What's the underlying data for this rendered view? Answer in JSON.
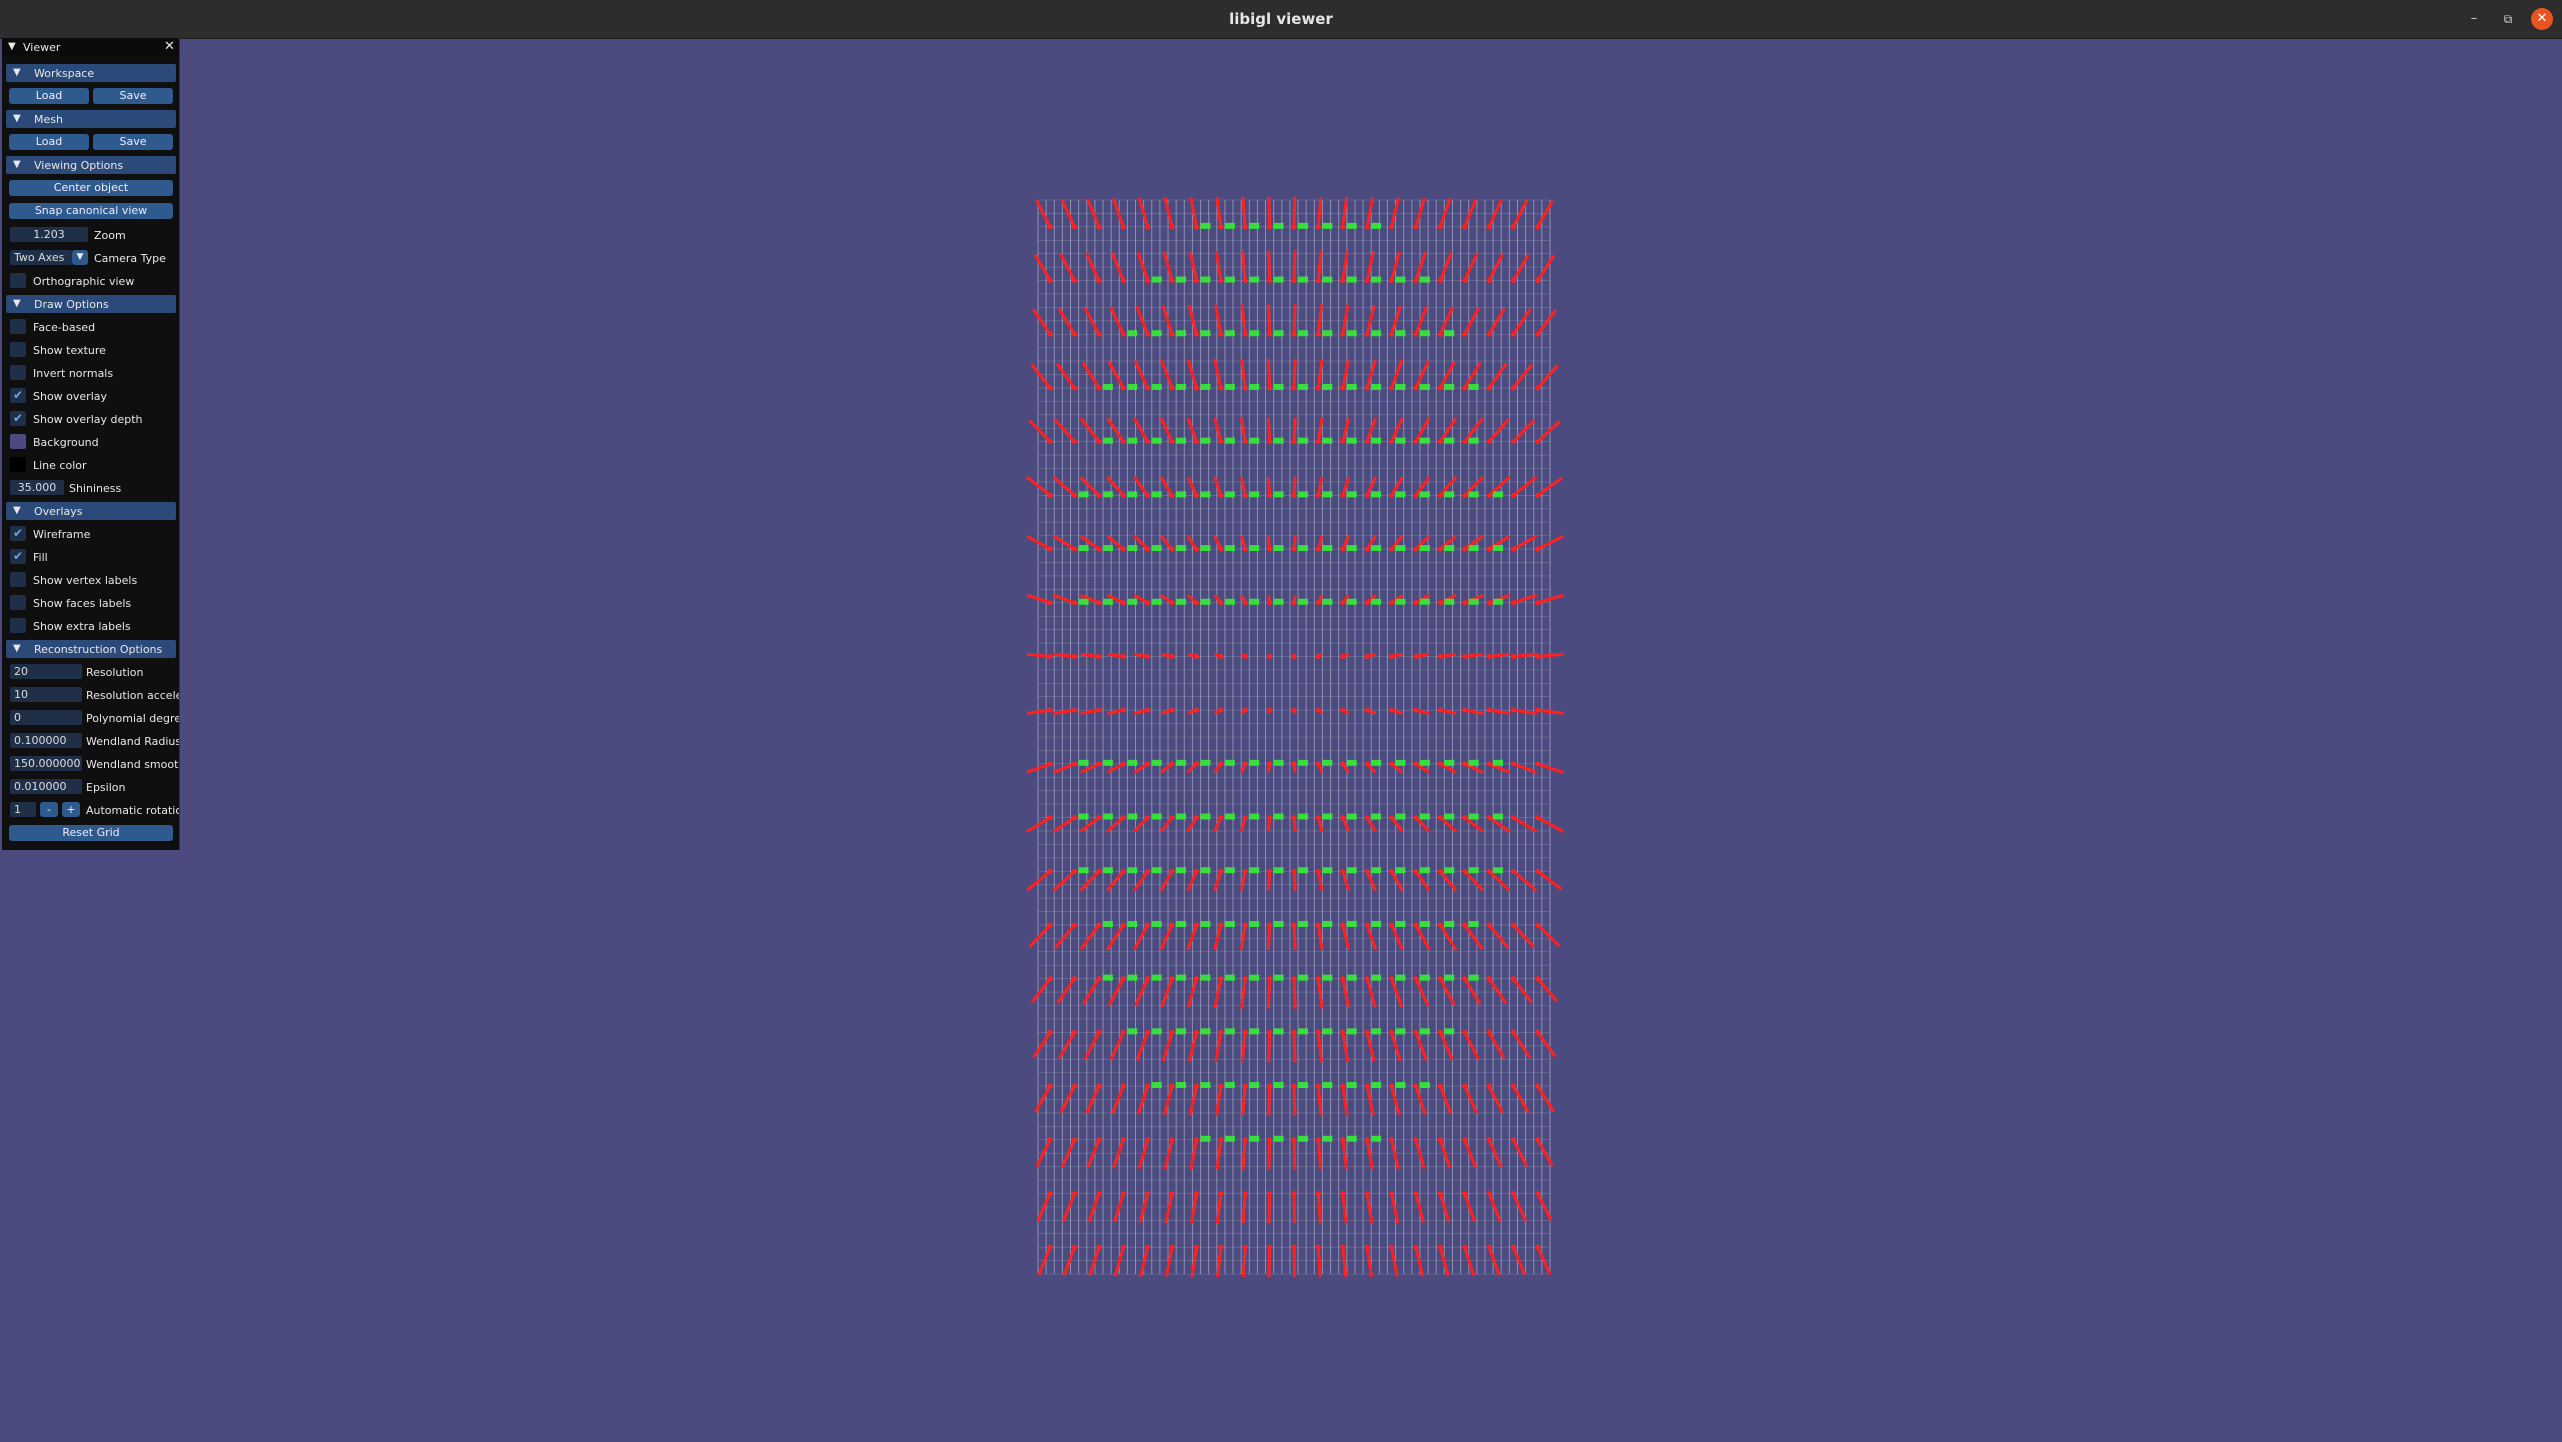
{
  "window": {
    "title": "libigl viewer"
  },
  "titlebar_icons": {
    "minimize": "–",
    "maximize": "⧉",
    "close": "✕"
  },
  "panel": {
    "title": "Viewer",
    "workspace": {
      "header": "Workspace",
      "load": "Load",
      "save": "Save"
    },
    "mesh": {
      "header": "Mesh",
      "load": "Load",
      "save": "Save"
    },
    "viewing": {
      "header": "Viewing Options",
      "center": "Center object",
      "snap": "Snap canonical view",
      "zoom_value": "1.203",
      "zoom_label": "Zoom",
      "camera_value": "Two Axes",
      "camera_label": "Camera Type",
      "ortho_label": "Orthographic view",
      "ortho_checked": false
    },
    "draw": {
      "header": "Draw Options",
      "items": [
        {
          "label": "Face-based",
          "checked": false
        },
        {
          "label": "Show texture",
          "checked": false
        },
        {
          "label": "Invert normals",
          "checked": false
        },
        {
          "label": "Show overlay",
          "checked": true
        },
        {
          "label": "Show overlay depth",
          "checked": true
        }
      ],
      "background_label": "Background",
      "background_color": "#4b4b7f",
      "linecolor_label": "Line color",
      "line_color": "#000000",
      "shininess_value": "35.000",
      "shininess_label": "Shininess"
    },
    "overlays": {
      "header": "Overlays",
      "items": [
        {
          "label": "Wireframe",
          "checked": true
        },
        {
          "label": "Fill",
          "checked": true
        },
        {
          "label": "Show vertex labels",
          "checked": false
        },
        {
          "label": "Show faces labels",
          "checked": false
        },
        {
          "label": "Show extra labels",
          "checked": false
        }
      ]
    },
    "recon": {
      "header": "Reconstruction Options",
      "fields": [
        {
          "value": "20",
          "label": "Resolution"
        },
        {
          "value": "10",
          "label": "Resolution acceler"
        },
        {
          "value": "0",
          "label": "Polynomial degree"
        },
        {
          "value": "0.100000",
          "label": "Wendland Radius"
        },
        {
          "value": "150.000000",
          "label": "Wendland smooth"
        },
        {
          "value": "0.010000",
          "label": "Epsilon"
        }
      ],
      "rotation_value": "1",
      "minus": "-",
      "plus": "+",
      "rotation_label": "Automatic rotatior",
      "reset": "Reset Grid"
    }
  },
  "scene": {
    "grid_columns": 21,
    "grid_rows": 20,
    "colors": {
      "background": "#4b4b7f",
      "normals": "#ff2020",
      "inside": "#33ee33",
      "mesh": "#c8c8d8"
    }
  }
}
